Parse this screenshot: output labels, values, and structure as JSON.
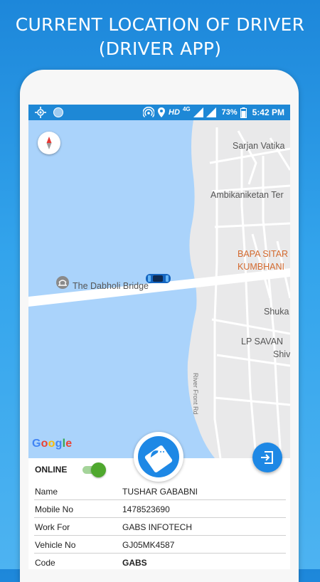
{
  "promo": {
    "line1": "CURRENT LOCATION OF DRIVER",
    "line2": "(DRIVER APP)"
  },
  "status_bar": {
    "hd": "HD",
    "network": "4G",
    "battery": "73%",
    "time": "5:42 PM",
    "icons": [
      "location-target-icon",
      "app-circle-icon",
      "hotspot-icon",
      "location-pin-icon",
      "signal-icon",
      "signal-icon",
      "battery-icon"
    ]
  },
  "map": {
    "labels": {
      "sarjan": "Sarjan Vatika",
      "ambika": "Ambikaniketan Ter",
      "bapa": "BAPA SITAR",
      "kumbhani": "KUMBHANI",
      "bridge": "The Dabholi Bridge",
      "shuka": "Shuka",
      "lpsavan": "LP SAVAN",
      "shiv": "Shiv",
      "road": "River Front Rd"
    },
    "google_letters": [
      {
        "ch": "G",
        "color": "#4285F4"
      },
      {
        "ch": "o",
        "color": "#EA4335"
      },
      {
        "ch": "o",
        "color": "#FBBC05"
      },
      {
        "ch": "g",
        "color": "#4285F4"
      },
      {
        "ch": "l",
        "color": "#34A853"
      },
      {
        "ch": "e",
        "color": "#EA4335"
      }
    ],
    "colors": {
      "water": "#aad3fb",
      "land": "#e9e9ea",
      "road": "#ffffff",
      "car": "#1565c0"
    }
  },
  "driver": {
    "online_label": "ONLINE",
    "online": true,
    "fields": [
      {
        "label": "Name",
        "value": "TUSHAR GABABNI",
        "bold": false
      },
      {
        "label": "Mobile No",
        "value": "1478523690",
        "bold": false
      },
      {
        "label": "Work For",
        "value": "GABS INFOTECH",
        "bold": false
      },
      {
        "label": "Vehicle No",
        "value": "GJ05MK4587",
        "bold": false
      },
      {
        "label": "Code",
        "value": "GABS",
        "bold": true
      }
    ]
  },
  "colors": {
    "accent": "#1e88e5",
    "toggle_on": "#4fa82e"
  }
}
